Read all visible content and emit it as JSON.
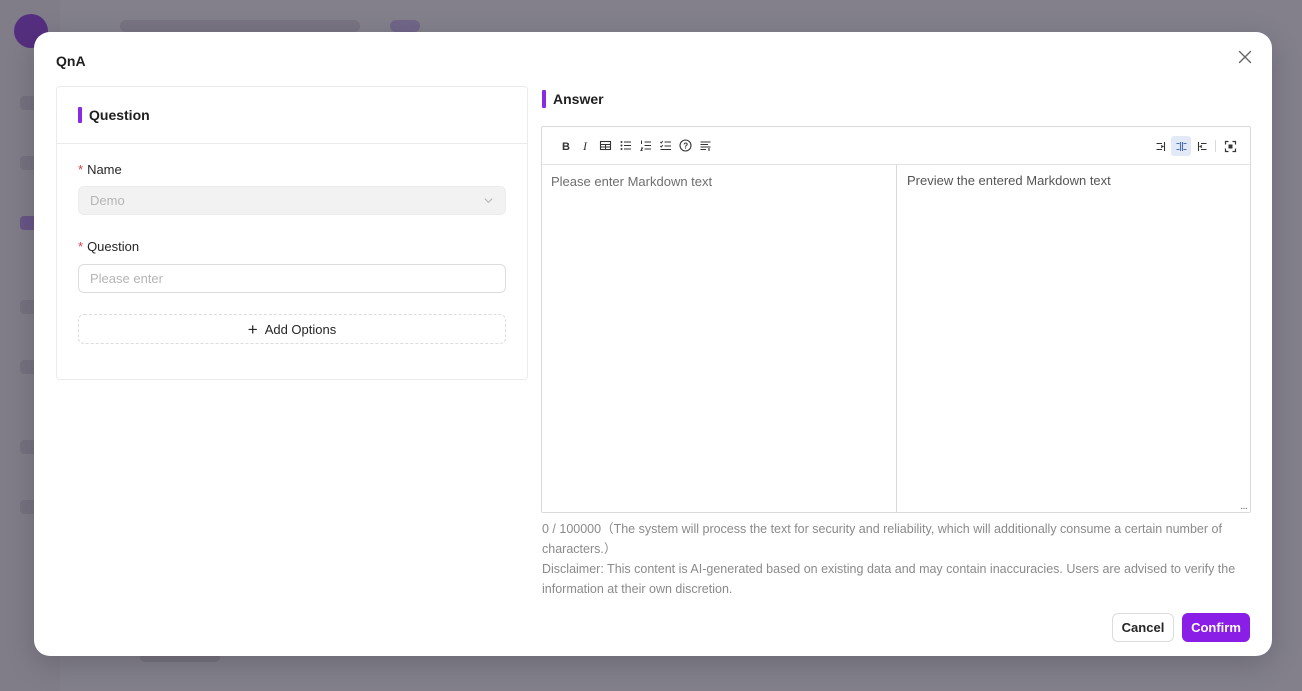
{
  "colors": {
    "accent": "#8a1ee6",
    "required": "#e03b3b",
    "overlay": "#6f6a78"
  },
  "modal": {
    "title": "QnA",
    "close_icon": "close-icon"
  },
  "question_panel": {
    "title": "Question",
    "name_field": {
      "label": "Name",
      "required_mark": "*",
      "value": "Demo",
      "disabled": true
    },
    "question_field": {
      "label": "Question",
      "required_mark": "*",
      "value": "",
      "placeholder": "Please enter"
    },
    "add_options_label": "Add Options"
  },
  "answer_panel": {
    "title": "Answer",
    "toolbar_left": [
      "bold-icon",
      "italic-icon",
      "table-icon",
      "unordered-list-icon",
      "ordered-list-icon",
      "task-list-icon",
      "help-icon",
      "toc-icon"
    ],
    "toolbar_right": [
      "edit-only-icon",
      "split-view-icon",
      "preview-only-icon",
      "fullscreen-icon"
    ],
    "active_view": "split-view-icon",
    "input_placeholder": "Please enter Markdown text",
    "input_value": "",
    "preview_placeholder": "Preview the entered Markdown text",
    "char_counter": "0 / 100000（The system will process the text for security and reliability, which will additionally consume a certain number of characters.）",
    "disclaimer": "Disclaimer: This content is AI-generated based on existing data and may contain inaccuracies. Users are advised to verify the information at their own discretion."
  },
  "footer": {
    "cancel_label": "Cancel",
    "confirm_label": "Confirm"
  }
}
